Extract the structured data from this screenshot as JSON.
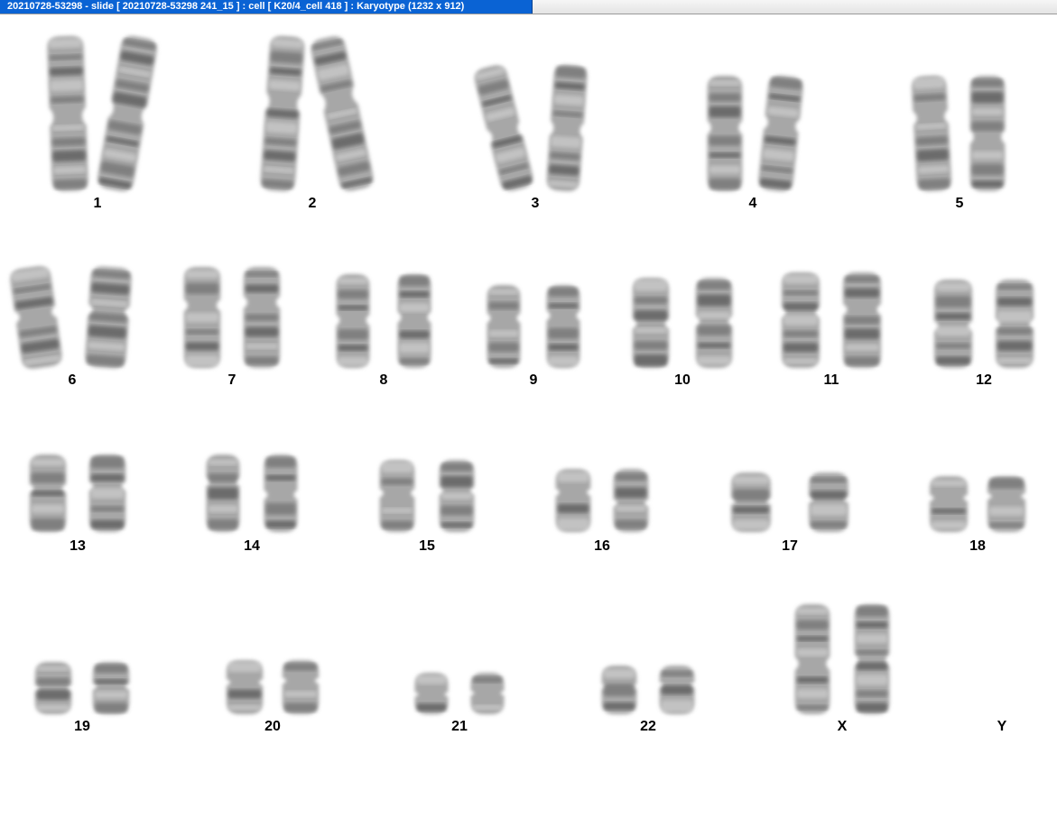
{
  "window": {
    "title": "20210728-53298 - slide [ 20210728-53298 241_15 ] : cell [ K20/4_cell 418 ] : Karyotype  (1232 x 912)"
  },
  "karyotype": {
    "chromosomes": [
      {
        "label": "1",
        "count": 2
      },
      {
        "label": "2",
        "count": 2
      },
      {
        "label": "3",
        "count": 2
      },
      {
        "label": "4",
        "count": 2
      },
      {
        "label": "5",
        "count": 2
      },
      {
        "label": "6",
        "count": 2
      },
      {
        "label": "7",
        "count": 2
      },
      {
        "label": "8",
        "count": 2
      },
      {
        "label": "9",
        "count": 2
      },
      {
        "label": "10",
        "count": 2
      },
      {
        "label": "11",
        "count": 2
      },
      {
        "label": "12",
        "count": 2
      },
      {
        "label": "13",
        "count": 2
      },
      {
        "label": "14",
        "count": 2
      },
      {
        "label": "15",
        "count": 2
      },
      {
        "label": "16",
        "count": 2
      },
      {
        "label": "17",
        "count": 2
      },
      {
        "label": "18",
        "count": 2
      },
      {
        "label": "19",
        "count": 2
      },
      {
        "label": "20",
        "count": 2
      },
      {
        "label": "21",
        "count": 2
      },
      {
        "label": "22",
        "count": 2
      },
      {
        "label": "X",
        "count": 2
      },
      {
        "label": "Y",
        "count": 0
      }
    ]
  }
}
